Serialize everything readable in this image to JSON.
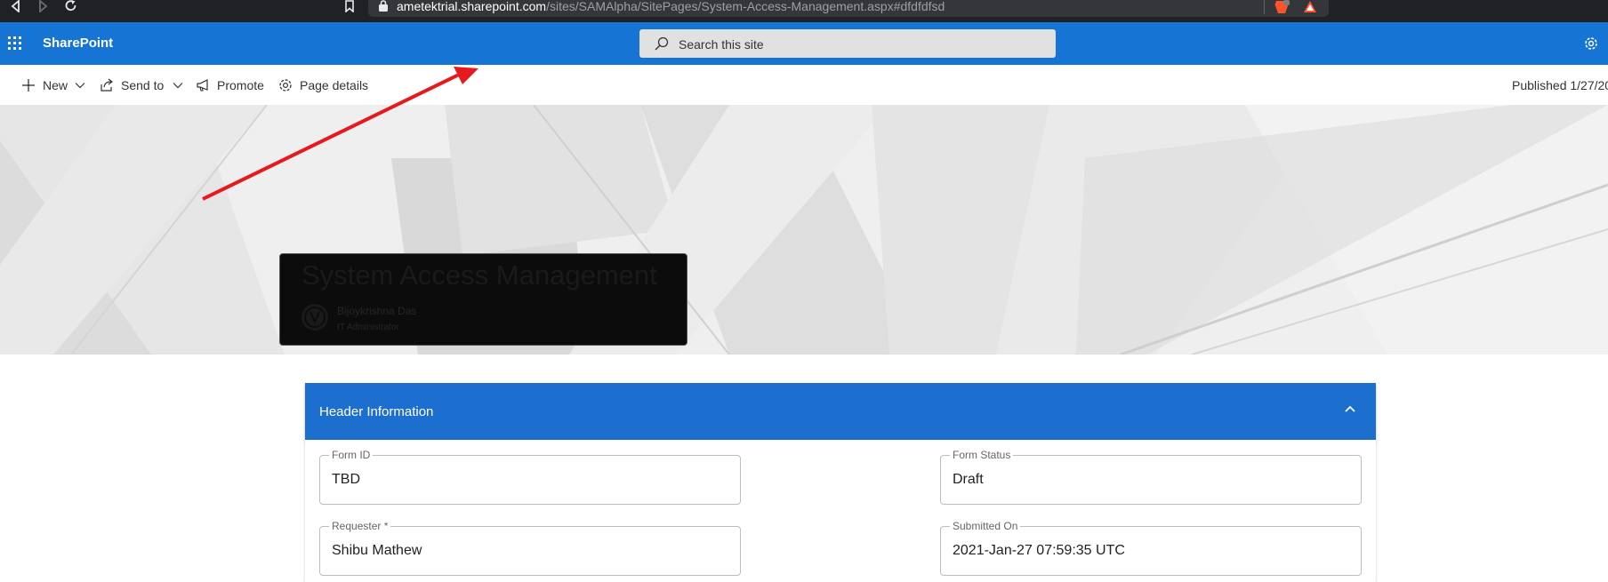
{
  "browser": {
    "url_host": "ametektrial.sharepoint.com",
    "url_path": "/sites/SAMAlpha/SitePages/System-Access-Management.aspx#dfdfdfsd"
  },
  "suite_bar": {
    "brand": "SharePoint",
    "search_placeholder": "Search this site"
  },
  "command_bar": {
    "items": [
      {
        "label": "New",
        "icon": "plus-icon",
        "has_dropdown": true
      },
      {
        "label": "Send to",
        "icon": "share-icon",
        "has_dropdown": true
      },
      {
        "label": "Promote",
        "icon": "megaphone-icon",
        "has_dropdown": false
      },
      {
        "label": "Page details",
        "icon": "gear-icon",
        "has_dropdown": false
      }
    ],
    "published": "Published 1/27/20"
  },
  "hero": {
    "title": "System Access Management",
    "author_name": "Bijoykrishna Das",
    "author_role": "IT Administrator"
  },
  "form": {
    "section_title": "Header Information",
    "fields": {
      "form_id": {
        "label": "Form ID",
        "value": "TBD"
      },
      "form_status": {
        "label": "Form Status",
        "value": "Draft"
      },
      "requester": {
        "label": "Requester *",
        "value": "Shibu Mathew"
      },
      "submitted_on": {
        "label": "Submitted On",
        "value": "2021-Jan-27 07:59:35 UTC"
      }
    }
  },
  "colors": {
    "suite_bar": "#1574d4",
    "section_header": "#1c6fcf",
    "annotation_arrow": "#e8191c"
  }
}
